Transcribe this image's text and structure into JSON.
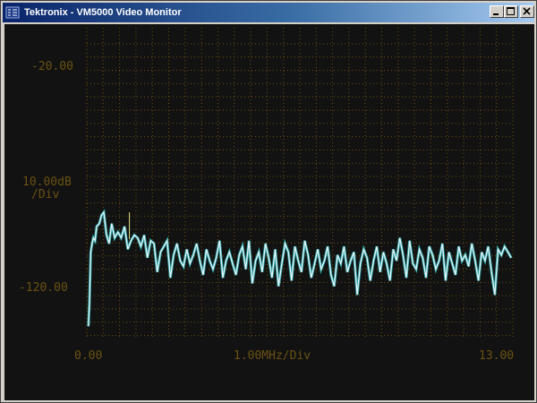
{
  "window": {
    "title": "Tektronix - VM5000 Video Monitor",
    "controls": {
      "minimize": "minimize",
      "maximize": "maximize",
      "close": "close"
    }
  },
  "colors": {
    "titlebar_start": "#0a246a",
    "titlebar_end": "#a6caf0",
    "screen_bg": "#121212",
    "graticule": "#6b5212",
    "label": "#6b5212",
    "trace": "#e6f2f6",
    "trace_shadow": "#2aa5a8",
    "marker": "#e0e080"
  },
  "display": {
    "ref_level": "-20.00",
    "scale": "10.00dB\n/Div",
    "bottom_level": "-120.00",
    "x_start": "0.00",
    "x_scale": "1.00MHz/Div",
    "x_stop": "13.00"
  },
  "chart_data": {
    "type": "line",
    "title": "",
    "xlabel": "1.00MHz/Div",
    "ylabel": "10.00dB/Div",
    "xlim": [
      0,
      13
    ],
    "ylim": [
      -130,
      -20
    ],
    "grid": true,
    "series": [
      {
        "x": [
          0.05,
          0.08,
          0.12,
          0.16,
          0.2,
          0.25,
          0.3,
          0.38,
          0.45,
          0.52,
          0.6,
          0.68,
          0.76,
          0.85,
          0.95,
          1.05,
          1.15,
          1.25,
          1.35,
          1.45,
          1.55,
          1.65,
          1.75,
          1.85,
          1.95,
          2.05,
          2.15,
          2.25,
          2.35,
          2.45,
          2.55,
          2.65,
          2.75,
          2.85,
          2.95,
          3.05,
          3.15,
          3.25,
          3.35,
          3.45,
          3.55,
          3.65,
          3.75,
          3.85,
          3.95,
          4.05,
          4.15,
          4.25,
          4.35,
          4.45,
          4.55,
          4.65,
          4.75,
          4.85,
          4.95,
          5.05,
          5.15,
          5.25,
          5.35,
          5.45,
          5.55,
          5.65,
          5.75,
          5.85,
          5.95,
          6.05,
          6.15,
          6.25,
          6.35,
          6.45,
          6.55,
          6.65,
          6.75,
          6.85,
          6.95,
          7.05,
          7.15,
          7.25,
          7.35,
          7.45,
          7.55,
          7.65,
          7.75,
          7.85,
          7.95,
          8.05,
          8.15,
          8.25,
          8.35,
          8.45,
          8.55,
          8.65,
          8.75,
          8.85,
          8.95,
          9.05,
          9.15,
          9.25,
          9.35,
          9.45,
          9.55,
          9.65,
          9.75,
          9.85,
          9.95,
          10.05,
          10.15,
          10.25,
          10.35,
          10.45,
          10.55,
          10.65,
          10.75,
          10.85,
          10.95,
          11.05,
          11.15,
          11.25,
          11.35,
          11.45,
          11.55,
          11.65,
          11.75,
          11.85,
          11.95,
          12.05,
          12.15,
          12.25,
          12.35,
          12.45,
          12.55,
          12.65,
          12.75,
          12.85,
          12.95
        ],
        "y": [
          -126,
          -118,
          -100,
          -97,
          -95,
          -96,
          -91,
          -90,
          -87,
          -86,
          -94,
          -97,
          -90,
          -95,
          -93,
          -95,
          -91,
          -99,
          -96,
          -94,
          -95,
          -98,
          -94,
          -102,
          -96,
          -97,
          -107,
          -100,
          -98,
          -96,
          -109,
          -101,
          -97,
          -103,
          -105,
          -99,
          -104,
          -101,
          -97,
          -103,
          -108,
          -99,
          -103,
          -106,
          -102,
          -96,
          -109,
          -103,
          -100,
          -104,
          -108,
          -101,
          -98,
          -106,
          -96,
          -111,
          -103,
          -100,
          -107,
          -97,
          -102,
          -109,
          -99,
          -112,
          -104,
          -97,
          -100,
          -110,
          -98,
          -103,
          -107,
          -96,
          -101,
          -109,
          -104,
          -99,
          -106,
          -103,
          -98,
          -108,
          -112,
          -101,
          -104,
          -98,
          -107,
          -103,
          -100,
          -115,
          -104,
          -99,
          -102,
          -110,
          -103,
          -98,
          -107,
          -100,
          -104,
          -110,
          -99,
          -103,
          -95,
          -101,
          -109,
          -96,
          -104,
          -106,
          -99,
          -102,
          -109,
          -98,
          -101,
          -106,
          -103,
          -97,
          -110,
          -100,
          -104,
          -108,
          -98,
          -103,
          -101,
          -105,
          -97,
          -103,
          -110,
          -100,
          -103,
          -98,
          -107,
          -115,
          -99,
          -101,
          -98,
          -100,
          -102
        ]
      }
    ],
    "marker_x": 1.3
  }
}
